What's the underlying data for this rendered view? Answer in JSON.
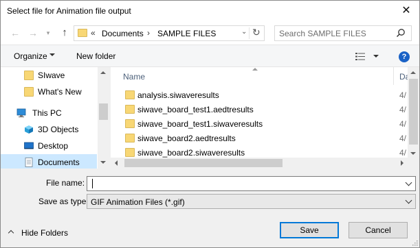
{
  "window": {
    "title": "Select file for Animation file output",
    "close_glyph": "✕"
  },
  "address": {
    "recent_glyph": "▾",
    "overflow": "«",
    "crumbs": [
      "Documents",
      "SAMPLE FILES"
    ],
    "separator": "›",
    "dropdown_glyph": "⌄",
    "refresh_glyph": "↻"
  },
  "search": {
    "placeholder": "Search SAMPLE FILES"
  },
  "toolbar": {
    "organize": "Organize",
    "new_folder": "New folder",
    "help": "?"
  },
  "nav": {
    "items": [
      {
        "label": "SIwave",
        "icon": "folder-icon"
      },
      {
        "label": "What's New",
        "icon": "folder-icon"
      },
      {
        "label": "This PC",
        "icon": "computer-icon"
      },
      {
        "label": "3D Objects",
        "icon": "cube-icon"
      },
      {
        "label": "Desktop",
        "icon": "desktop-icon"
      },
      {
        "label": "Documents",
        "icon": "documents-icon",
        "selected": true
      }
    ]
  },
  "files": {
    "columns": {
      "name": "Name",
      "date": "Da"
    },
    "rows": [
      {
        "name": "analysis.siwaveresults",
        "date": "4/"
      },
      {
        "name": "siwave_board_test1.aedtresults",
        "date": "4/"
      },
      {
        "name": "siwave_board_test1.siwaveresults",
        "date": "4/"
      },
      {
        "name": "siwave_board2.aedtresults",
        "date": "4/"
      },
      {
        "name": "siwave_board2.siwaveresults",
        "date": "4/"
      }
    ]
  },
  "form": {
    "file_name_label": "File name:",
    "file_name_value": "",
    "save_as_label": "Save as type:",
    "save_as_value": "GIF Animation Files (*.gif)"
  },
  "footer": {
    "hide_folders": "Hide Folders",
    "save": "Save",
    "cancel": "Cancel"
  },
  "colors": {
    "accent": "#0078d7",
    "selection": "#cce8ff",
    "folder": "#f8d775",
    "help": "#1a62c6"
  }
}
